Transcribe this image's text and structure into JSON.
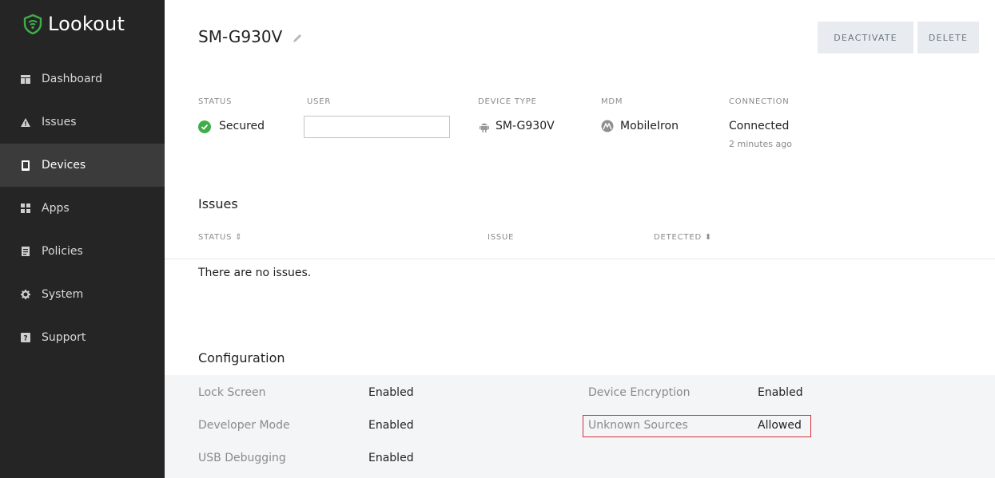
{
  "sidebar": {
    "brand": "Lookout",
    "items": [
      {
        "label": "Dashboard",
        "icon": "dashboard-icon"
      },
      {
        "label": "Issues",
        "icon": "warning-icon"
      },
      {
        "label": "Devices",
        "icon": "device-icon",
        "active": true
      },
      {
        "label": "Apps",
        "icon": "apps-grid-icon"
      },
      {
        "label": "Policies",
        "icon": "policies-icon"
      },
      {
        "label": "System",
        "icon": "gear-icon"
      },
      {
        "label": "Support",
        "icon": "support-icon"
      }
    ]
  },
  "header": {
    "device_name": "SM-G930V",
    "deactivate_label": "DEACTIVATE",
    "delete_label": "DELETE"
  },
  "summary": {
    "status_label": "STATUS",
    "status_value": "Secured",
    "user_label": "USER",
    "user_value": "",
    "device_type_label": "DEVICE TYPE",
    "device_type_value": "SM-G930V",
    "mdm_label": "MDM",
    "mdm_value": "MobileIron",
    "connection_label": "CONNECTION",
    "connection_value": "Connected",
    "connection_time": "2 minutes ago"
  },
  "issues": {
    "title": "Issues",
    "columns": [
      "STATUS ⇕",
      "ISSUE",
      "DETECTED ⬍"
    ],
    "empty_text": "There are no issues."
  },
  "configuration": {
    "title": "Configuration",
    "rows": [
      {
        "label": "Lock Screen",
        "value": "Enabled"
      },
      {
        "label": "Developer Mode",
        "value": "Enabled"
      },
      {
        "label": "USB Debugging",
        "value": "Enabled"
      },
      {
        "label": "Device Encryption",
        "value": "Enabled"
      },
      {
        "label": "Unknown Sources",
        "value": "Allowed"
      }
    ]
  },
  "colors": {
    "sidebar_bg": "#252525",
    "active_item_bg": "#3b3b3b",
    "brand_green": "#3fae49",
    "highlight_red": "#d6323a"
  }
}
